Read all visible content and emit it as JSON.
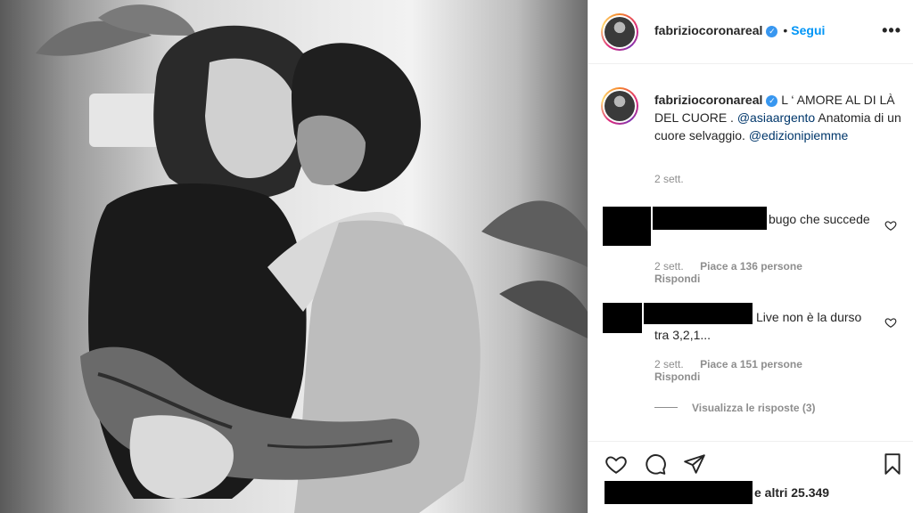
{
  "post": {
    "image_description_icon": "photo-couple-bw"
  },
  "header": {
    "username": "fabriziocoronareal",
    "verified_icon": "verified-badge-icon",
    "separator": "•",
    "follow_label": "Segui",
    "more_label": "•••"
  },
  "caption": {
    "username": "fabriziocoronareal",
    "text_part1": " L ‘ AMORE AL DI LÀ DEL CUORE . ",
    "mention1": "@asiaargento",
    "text_part2": " Anatomia di un cuore selvaggio. ",
    "mention2": "@edizionipiemme",
    "time": "2 sett."
  },
  "comments": [
    {
      "text_visible": "bugo che succede",
      "time": "2 sett.",
      "likes": "Piace a 136 persone",
      "reply": "Rispondi"
    },
    {
      "text_visible": "Live non è la durso tra 3,2,1...",
      "time": "2 sett.",
      "likes": "Piace a 151 persone",
      "reply": "Rispondi",
      "view_replies": "Visualizza le risposte (3)"
    }
  ],
  "footer": {
    "likes_text": "e altri 25.349"
  },
  "colors": {
    "link_blue": "#0095f6",
    "mention_blue": "#00376b",
    "muted_gray": "#8e8e8e",
    "text": "#262626",
    "verified": "#3897f0"
  }
}
